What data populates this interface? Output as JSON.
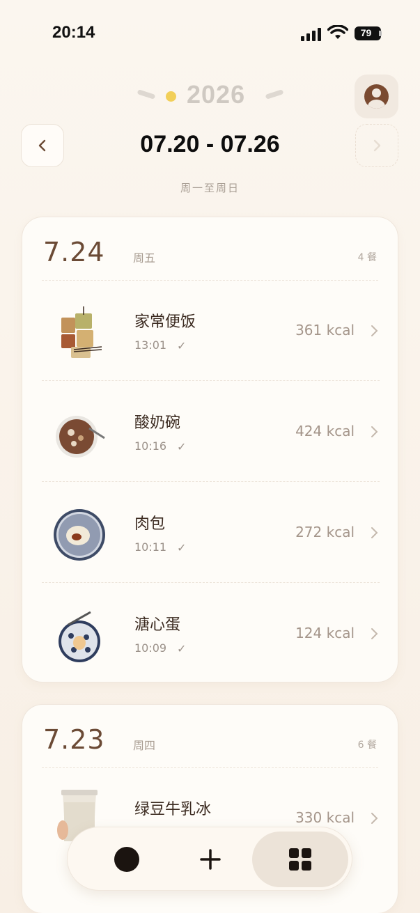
{
  "status_bar": {
    "time": "20:14",
    "battery": "79"
  },
  "header": {
    "year": "2026",
    "range": "07.20 - 07.26",
    "subtitle": "周一至周日"
  },
  "days": [
    {
      "date": "7.24",
      "weekday": "周五",
      "count": "4 餐",
      "meals": [
        {
          "name": "家常便饭",
          "time": "13:01",
          "kcal": "361 kcal",
          "checked": "✓"
        },
        {
          "name": "酸奶碗",
          "time": "10:16",
          "kcal": "424 kcal",
          "checked": "✓"
        },
        {
          "name": "肉包",
          "time": "10:11",
          "kcal": "272 kcal",
          "checked": "✓"
        },
        {
          "name": "溏心蛋",
          "time": "10:09",
          "kcal": "124 kcal",
          "checked": "✓"
        }
      ]
    },
    {
      "date": "7.23",
      "weekday": "周四",
      "count": "6 餐",
      "meals": [
        {
          "name": "绿豆牛乳冰",
          "time": "",
          "kcal": "330 kcal"
        }
      ]
    }
  ],
  "tabbar": {
    "items": [
      "record-dot-icon",
      "add-icon",
      "grid-icon"
    ],
    "active": "grid-icon"
  },
  "colors": {
    "accent_dot": "#f2cf58",
    "brown": "#6b4a35",
    "active_tab": "#ece3d8"
  }
}
